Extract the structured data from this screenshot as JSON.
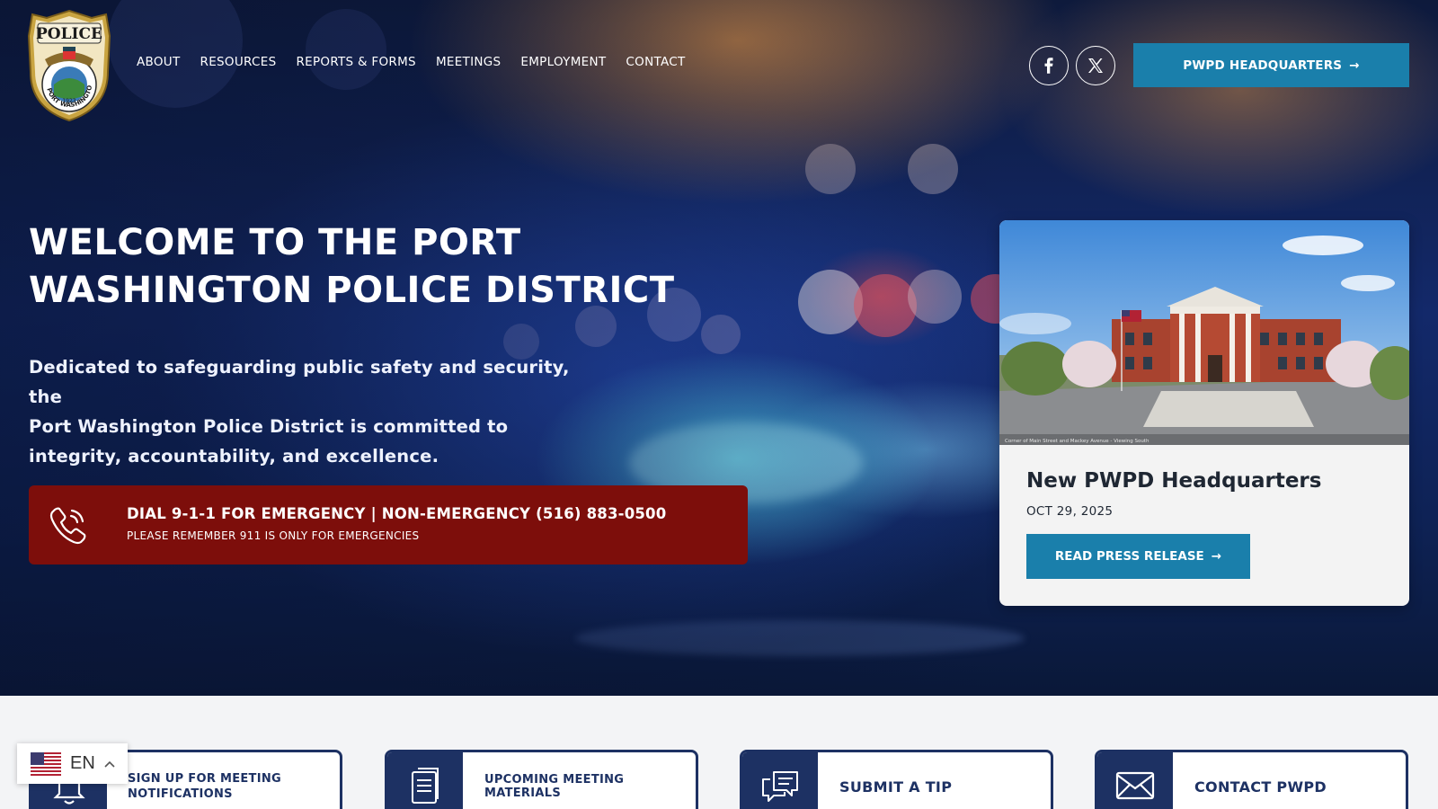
{
  "header": {
    "logo": {
      "icon": "police-badge-logo",
      "text_top": "POLICE",
      "text_ring": "PORT WASHINGTON, N.Y.",
      "year": "1923"
    },
    "nav": [
      {
        "label": "ABOUT"
      },
      {
        "label": "RESOURCES"
      },
      {
        "label": "REPORTS & FORMS"
      },
      {
        "label": "MEETINGS"
      },
      {
        "label": "EMPLOYMENT"
      },
      {
        "label": "CONTACT"
      }
    ],
    "social": [
      {
        "icon": "facebook-icon"
      },
      {
        "icon": "x-twitter-icon"
      }
    ],
    "hq_button": {
      "label": "PWPD HEADQUARTERS",
      "arrow": "→"
    }
  },
  "hero": {
    "title_line1": "WELCOME TO THE PORT",
    "title_line2": "WASHINGTON POLICE DISTRICT",
    "subtitle_line1": "Dedicated to safeguarding public safety and security, the",
    "subtitle_line2": "Port Washington Police District is committed to",
    "subtitle_line3": "integrity, accountability, and excellence.",
    "emergency": {
      "icon": "phone-icon",
      "main": "DIAL 9-1-1 FOR EMERGENCY | NON-EMERGENCY (516) 883-0500",
      "note": "PLEASE REMEMBER 911 IS ONLY FOR EMERGENCIES",
      "color": "#7d0e0b"
    }
  },
  "news": {
    "image_caption": "Corner of Main Street and Mackey Avenue - Viewing South",
    "title": "New PWPD Headquarters",
    "date": "OCT 29, 2025",
    "button": {
      "label": "READ PRESS RELEASE",
      "arrow": "→"
    }
  },
  "quick_links": [
    {
      "label_line1": "SIGN UP FOR MEETING",
      "label_line2": "NOTIFICATIONS",
      "icon": "bell-icon"
    },
    {
      "label_line1": "UPCOMING MEETING MATERIALS",
      "label_line2": "",
      "icon": "document-icon"
    },
    {
      "label_line1": "SUBMIT A TIP",
      "label_line2": "",
      "icon": "chat-bubbles-icon"
    },
    {
      "label_line1": "CONTACT PWPD",
      "label_line2": "",
      "icon": "envelope-icon"
    }
  ],
  "language": {
    "code": "EN",
    "flag": "us-flag-icon",
    "chevron": "chevron-up-icon"
  },
  "colors": {
    "accent": "#1a7fab",
    "navy": "#1d3163",
    "emergency_red": "#7d0e0b"
  }
}
